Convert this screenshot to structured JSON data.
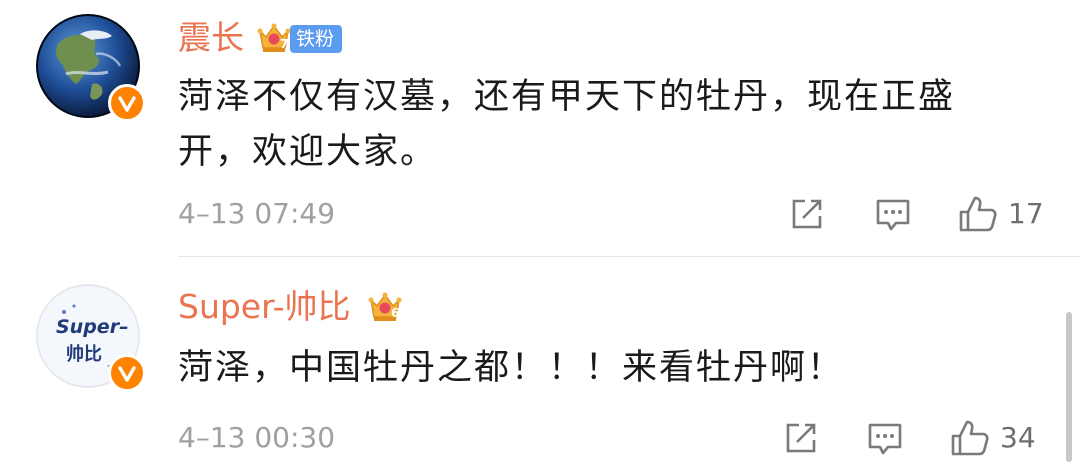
{
  "comments": [
    {
      "username": "震长",
      "fan_badge": "铁粉",
      "crown_level": "7",
      "avatar_icon": "earth-globe-avatar",
      "verified": true,
      "text_line1": "菏泽不仅有汉墓，还有甲天下的牡丹，现在正盛",
      "text_line2": "开，欢迎大家。",
      "time": "4–13 07:49",
      "like_count": "17"
    },
    {
      "username": "Super-帅比",
      "crown_level": "6",
      "avatar_text_top": "Super–",
      "avatar_text_bottom": "帅比",
      "verified": true,
      "text_line1": "菏泽，中国牡丹之都！！！来看牡丹啊！",
      "time": "4–13 00:30",
      "like_count": "34"
    }
  ],
  "colors": {
    "username": "#eb7350",
    "verified_badge": "#ff8200",
    "fan_badge": "#5b9bf0",
    "text": "#1a1a1a",
    "meta": "#a0a0a0"
  }
}
